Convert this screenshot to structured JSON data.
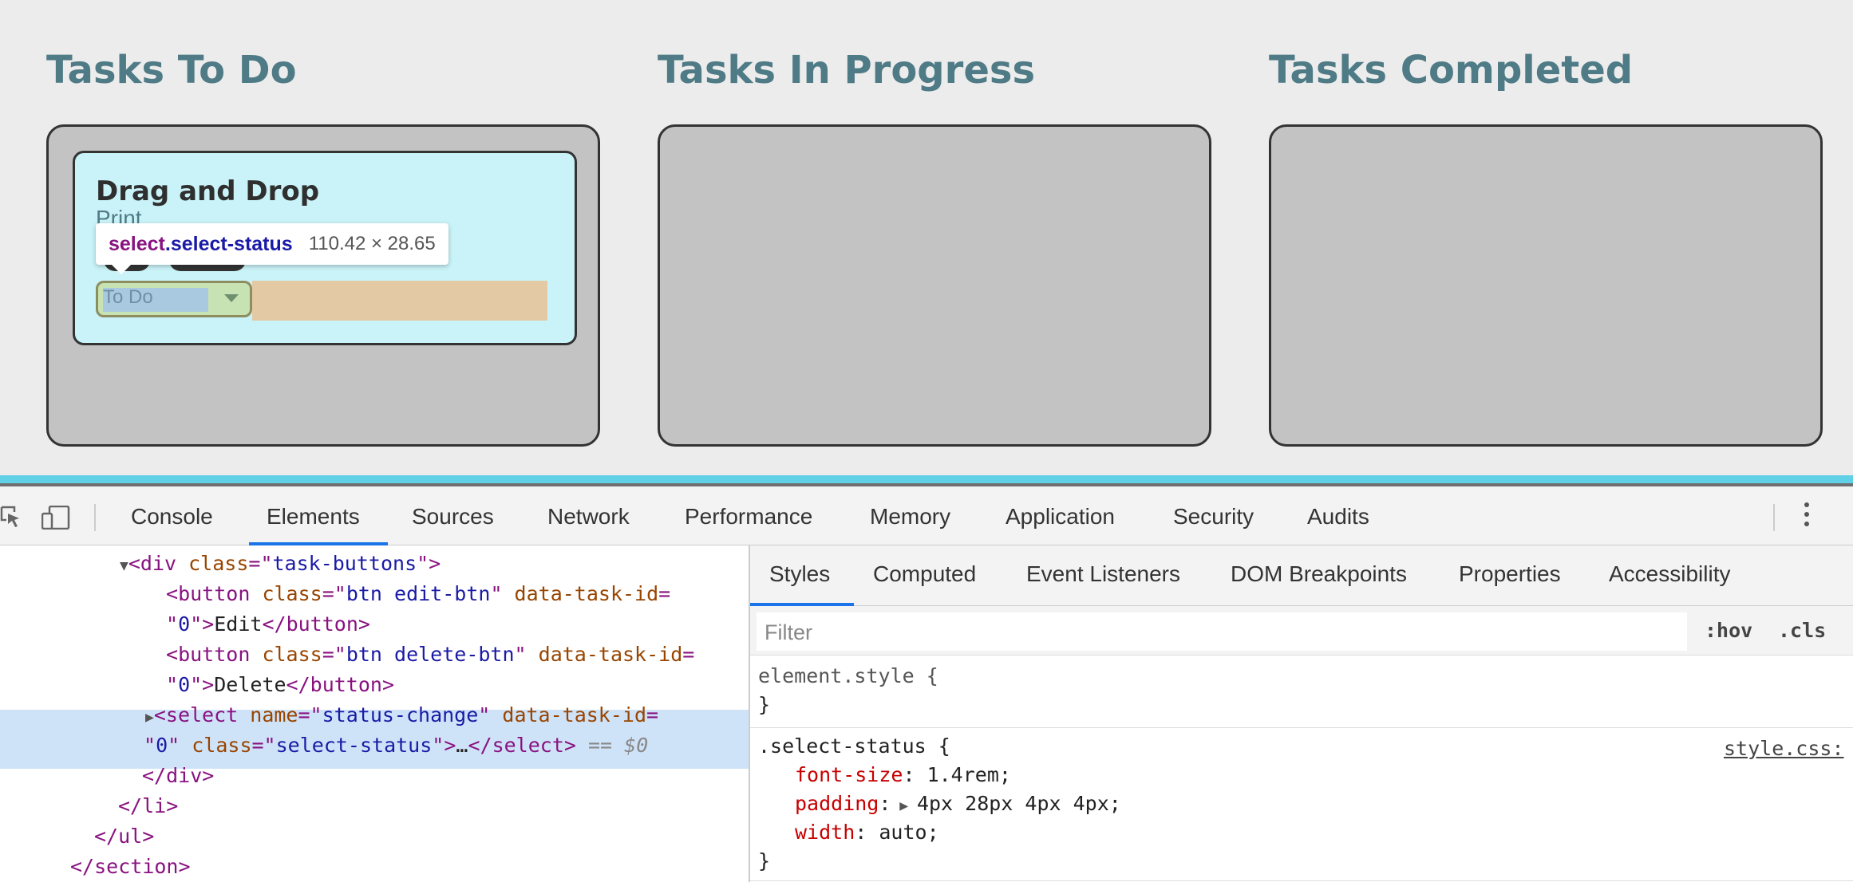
{
  "app": {
    "columns": [
      {
        "title": "Tasks To Do"
      },
      {
        "title": "Tasks In Progress"
      },
      {
        "title": "Tasks Completed"
      }
    ],
    "card": {
      "title": "Drag and Drop",
      "description": "Print",
      "select_value": "To Do"
    },
    "tooltip": {
      "tag": "select",
      "class": ".select-status",
      "size": "110.42 × 28.65"
    }
  },
  "devtools": {
    "tabs": [
      "Console",
      "Elements",
      "Sources",
      "Network",
      "Performance",
      "Memory",
      "Application",
      "Security",
      "Audits"
    ],
    "active_tab": "Elements",
    "dom": {
      "l1_tag": "div",
      "l1_attr": "class",
      "l1_val": "task-buttons",
      "l2_tag": "button",
      "l2_attr1": "class",
      "l2_val1": "btn edit-btn",
      "l2_attr2": "data-task-id",
      "l3_val": "0",
      "l3_text": "Edit",
      "l3_close": "button",
      "l4_tag": "button",
      "l4_attr1": "class",
      "l4_val1": "btn delete-btn",
      "l4_attr2": "data-task-id",
      "l5_val": "0",
      "l5_text": "Delete",
      "l5_close": "button",
      "l6_tag": "select",
      "l6_attr1": "name",
      "l6_val1": "status-change",
      "l6_attr2": "data-task-id",
      "l7_val": "0",
      "l7_attr": "class",
      "l7_val2": "select-status",
      "l7_ellipsis": "…",
      "l7_close": "select",
      "l7_eq": " == ",
      "l7_dollar": "$0",
      "l8_close": "div",
      "l9_close": "li",
      "l10_close": "ul",
      "l11_close": "section"
    },
    "styles": {
      "tabs": [
        "Styles",
        "Computed",
        "Event Listeners",
        "DOM Breakpoints",
        "Properties",
        "Accessibility"
      ],
      "filter_placeholder": "Filter",
      "hov": ":hov",
      "cls": ".cls",
      "element_style": "element.style {",
      "close_brace": "}",
      "rule_selector": ".select-status {",
      "source": "style.css:",
      "props": [
        {
          "name": "font-size",
          "value": "1.4rem;"
        },
        {
          "name": "padding",
          "value": "4px 28px 4px 4px;"
        },
        {
          "name": "width",
          "value": "auto;"
        }
      ]
    }
  }
}
